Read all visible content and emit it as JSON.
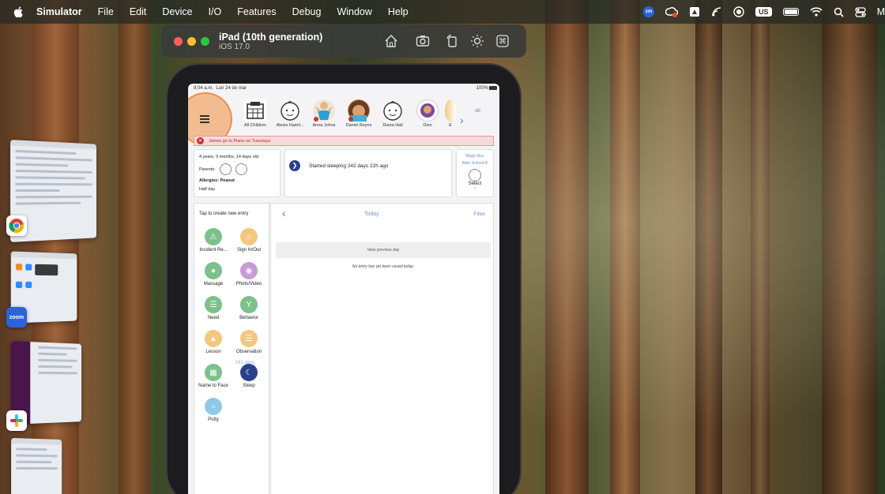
{
  "menubar": {
    "app_name": "Simulator",
    "items": [
      "File",
      "Edit",
      "Device",
      "I/O",
      "Features",
      "Debug",
      "Window",
      "Help"
    ],
    "zoom_badge": "zm",
    "input_source": "US",
    "trailing_letter": "M"
  },
  "simulator": {
    "device_name": "iPad (10th generation)",
    "os_version": "iOS 17.0"
  },
  "dock": {
    "zoom_label": "zoom"
  },
  "ipad": {
    "status": {
      "time": "9:04 a.m.",
      "date": "Lun 24 de mar",
      "battery": "100%"
    },
    "all_link": "All",
    "children": [
      {
        "name": "All Children"
      },
      {
        "name": "Alexis Hamil..."
      },
      {
        "name": "Anna Johns"
      },
      {
        "name": "Daniel Reyes"
      },
      {
        "name": "Diana Hall"
      },
      {
        "name": "Dion"
      },
      {
        "name": "E"
      }
    ],
    "alert": "James go to Piano on Tuesdays",
    "profile": {
      "age": "4 years, 9 months, 14 days old",
      "parents_label": "Parents:",
      "allergies": "Allergies: Peanut",
      "schedule": "Half day"
    },
    "sleep_card": {
      "text": "Started sleeping 242 days 22h ago"
    },
    "bus_card": {
      "line1": "Magic Bus",
      "line2": "After School-B",
      "select": "Select"
    },
    "entries_title": "Tap to create new entry",
    "entries": [
      {
        "label": "Incident Re...",
        "color": "#7cc08a"
      },
      {
        "label": "Sign In/Out",
        "color": "#f3c77e"
      },
      {
        "label": "Massage",
        "color": "#7cc08a"
      },
      {
        "label": "Photo/Video",
        "color": "#c89ad6"
      },
      {
        "label": "Need",
        "color": "#7cc08a"
      },
      {
        "label": "Behavior",
        "color": "#7cc08a"
      },
      {
        "label": "Lesson",
        "color": "#f3c77e"
      },
      {
        "label": "Observation",
        "color": "#f3c77e"
      },
      {
        "label": "Name to Face",
        "color": "#7cc08a"
      },
      {
        "label": "Sleep",
        "color": "#2b3f8c",
        "badge": "242 days"
      },
      {
        "label": "Potty",
        "color": "#8fc9e8"
      }
    ],
    "feed": {
      "title": "Today",
      "filter": "Filter",
      "prev_day": "View previous day",
      "empty": "No entry has yet been saved today"
    }
  }
}
